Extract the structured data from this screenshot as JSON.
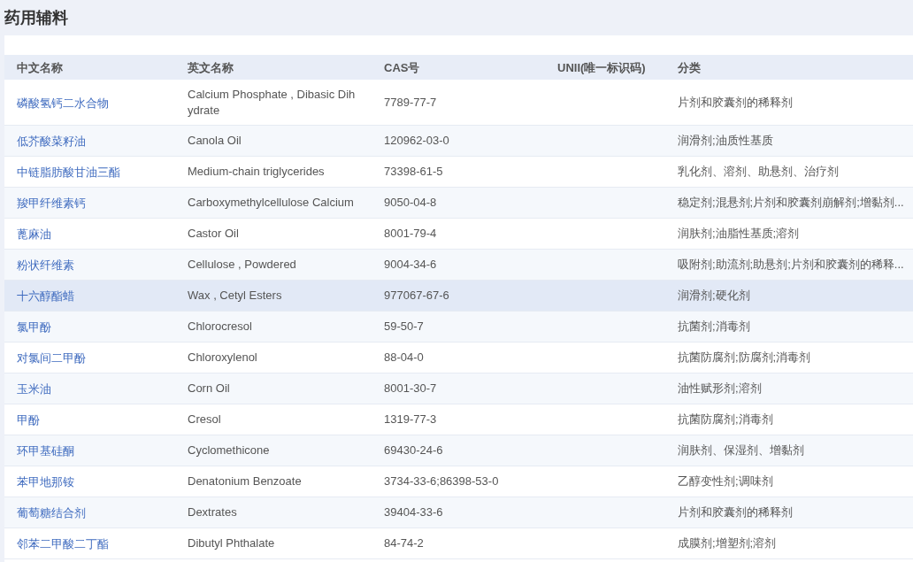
{
  "title": "药用辅料",
  "table": {
    "columns": [
      "中文名称",
      "英文名称",
      "CAS号",
      "UNII(唯一标识码)",
      "分类"
    ],
    "rows": [
      {
        "cells": [
          "磷酸氢钙二水合物",
          "Calcium Phosphate , Dibasic Dihydrate",
          "7789-77-7",
          "",
          "片剂和胶囊剂的稀释剂"
        ],
        "highlighted": false
      },
      {
        "cells": [
          "低芥酸菜籽油",
          "Canola Oil",
          "120962-03-0",
          "",
          "润滑剂;油质性基质"
        ],
        "highlighted": false
      },
      {
        "cells": [
          "中链脂肪酸甘油三酯",
          "Medium-chain triglycerides",
          "73398-61-5",
          "",
          "乳化剂、溶剂、助悬剂、治疗剂"
        ],
        "highlighted": false
      },
      {
        "cells": [
          "羧甲纤维素钙",
          "Carboxymethylcellulose Calcium",
          "9050-04-8",
          "",
          "稳定剂;混悬剂;片剂和胶囊剂崩解剂;增黏剂..."
        ],
        "highlighted": false
      },
      {
        "cells": [
          "蓖麻油",
          "Castor Oil",
          "8001-79-4",
          "",
          "润肤剂;油脂性基质;溶剂"
        ],
        "highlighted": false
      },
      {
        "cells": [
          "粉状纤维素",
          "Cellulose , Powdered",
          "9004-34-6",
          "",
          "吸附剂;助流剂;助悬剂;片剂和胶囊剂的稀释..."
        ],
        "highlighted": false
      },
      {
        "cells": [
          "十六醇酯蜡",
          "Wax , Cetyl Esters",
          "977067-67-6",
          "",
          "润滑剂;硬化剂"
        ],
        "highlighted": true
      },
      {
        "cells": [
          "氯甲酚",
          "Chlorocresol",
          "59-50-7",
          "",
          "抗菌剂;消毒剂"
        ],
        "highlighted": false
      },
      {
        "cells": [
          "对氯间二甲酚",
          "Chloroxylenol",
          "88-04-0",
          "",
          "抗菌防腐剂;防腐剂;消毒剂"
        ],
        "highlighted": false
      },
      {
        "cells": [
          "玉米油",
          "Corn Oil",
          "8001-30-7",
          "",
          "油性赋形剂;溶剂"
        ],
        "highlighted": false
      },
      {
        "cells": [
          "甲酚",
          "Cresol",
          "1319-77-3",
          "",
          "抗菌防腐剂;消毒剂"
        ],
        "highlighted": false
      },
      {
        "cells": [
          "环甲基硅酮",
          "Cyclomethicone",
          "69430-24-6",
          "",
          "润肤剂、保湿剂、增黏剂"
        ],
        "highlighted": false
      },
      {
        "cells": [
          "苯甲地那铵",
          "Denatonium Benzoate",
          "3734-33-6;86398-53-0",
          "",
          "乙醇变性剂;调味剂"
        ],
        "highlighted": false
      },
      {
        "cells": [
          "葡萄糖结合剂",
          "Dextrates",
          "39404-33-6",
          "",
          "片剂和胶囊剂的稀释剂"
        ],
        "highlighted": false
      },
      {
        "cells": [
          "邻苯二甲酸二丁酯",
          "Dibutyl Phthalate",
          "84-74-2",
          "",
          "成膜剂;增塑剂;溶剂"
        ],
        "highlighted": false
      }
    ]
  }
}
